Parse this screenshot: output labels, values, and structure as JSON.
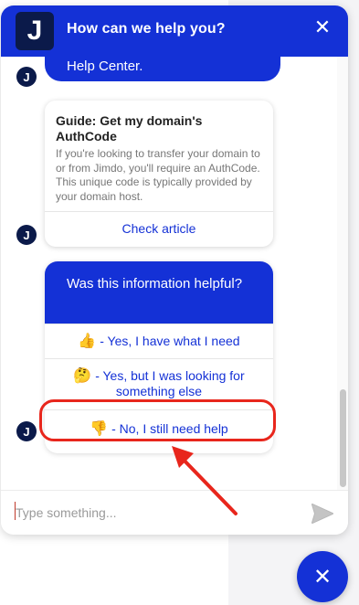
{
  "header": {
    "logo_letter": "J",
    "title": "How can we help you?",
    "close_glyph": "✕"
  },
  "previous_message": {
    "text": "Help Center."
  },
  "avatar_letter": "J",
  "article_card": {
    "title": "Guide: Get my domain's AuthCode",
    "body": "If you're looking to transfer your domain to or from Jimdo, you'll require an AuthCode. This unique code is typically provided by your domain host.",
    "link_label": "Check article"
  },
  "feedback_poll": {
    "question": "Was this information helpful?",
    "options": [
      {
        "emoji": "👍",
        "label": "- Yes, I have what I need"
      },
      {
        "emoji": "🤔",
        "label": "- Yes, but I was looking for something else"
      },
      {
        "emoji": "👎",
        "label": "- No, I still need help"
      }
    ]
  },
  "composer": {
    "placeholder": "Type something...",
    "send_icon": "send-icon"
  },
  "launcher": {
    "close_glyph": "✕"
  },
  "colors": {
    "brand": "#1431d6",
    "logo_bg": "#0b1a4a",
    "annotation": "#e8261c"
  }
}
